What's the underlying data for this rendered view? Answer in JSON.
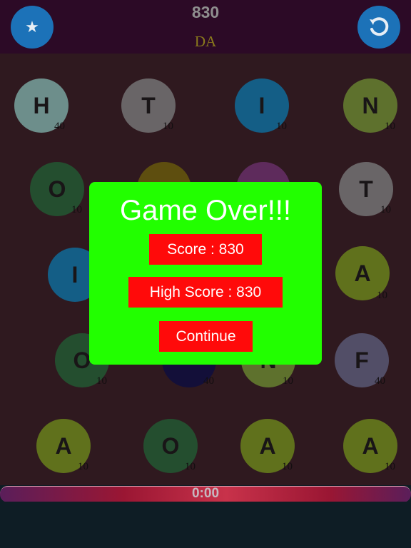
{
  "header": {
    "score": "830",
    "current_word": "DA",
    "left_button_icon": "star-icon",
    "right_button_icon": "undo-icon",
    "button_color": "#1c72b8"
  },
  "board": {
    "rows": [
      [
        {
          "letter": "H",
          "points": "40",
          "color": "#8fc3bb"
        },
        {
          "letter": "T",
          "points": "10",
          "color": "#8a8a8a"
        },
        {
          "letter": "I",
          "points": "10",
          "color": "#1480b4"
        },
        {
          "letter": "N",
          "points": "10",
          "color": "#7a9a3a"
        }
      ],
      [
        {
          "letter": "O",
          "points": "10",
          "color": "#2a6a3c"
        },
        {
          "letter": "T",
          "points": "10",
          "color": "#8a8a8a"
        }
      ],
      [
        {
          "letter": "I",
          "points": "",
          "color": "#1480b4"
        },
        {
          "letter": "A",
          "points": "10",
          "color": "#7d9a22"
        }
      ],
      [
        {
          "letter": "O",
          "points": "10",
          "color": "#2a6a3c"
        },
        {
          "letter": "",
          "points": "40",
          "color": "#12124a"
        },
        {
          "letter": "N",
          "points": "10",
          "color": "#7a9a3a"
        },
        {
          "letter": "F",
          "points": "40",
          "color": "#6a6a8a"
        }
      ],
      [
        {
          "letter": "A",
          "points": "10",
          "color": "#7d9a22"
        },
        {
          "letter": "O",
          "points": "10",
          "color": "#2a6a3c"
        },
        {
          "letter": "A",
          "points": "10",
          "color": "#7d9a22"
        },
        {
          "letter": "A",
          "points": "10",
          "color": "#7d9a22"
        }
      ]
    ],
    "hidden_tiles": [
      {
        "letter": "",
        "color": "#7a6a10"
      },
      {
        "letter": "",
        "color": "#7a3a7a"
      }
    ]
  },
  "timer": "0:00",
  "dialog": {
    "title": "Game Over!!!",
    "score_label": "Score : 830",
    "high_score_label": "High Score : 830",
    "continue_label": "Continue",
    "background": "#22ff00",
    "button_color": "#ff0a0a"
  }
}
